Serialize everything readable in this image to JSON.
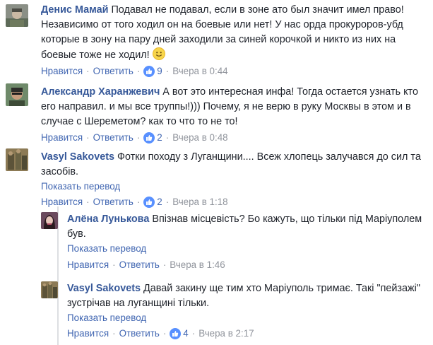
{
  "comments": [
    {
      "author": "Денис Мамай",
      "text": " Подавал не подавал, если в зоне ато был значит имел право! Независимо от того ходил он на боевые или нет! У нас орда прокуроров-убд которые в зону на пару дней заходили за синей корочкой и никто из них на боевые тоже не ходил! ",
      "emoji": "smile-emoji",
      "like_label": "Нравится",
      "reply_label": "Ответить",
      "likes": "9",
      "time": "Вчера в 0:44"
    },
    {
      "author": "Александр Харанжевич",
      "text": " А вот это интересная инфа! Тогда остается узнать кто его направил. и мы все труппы!))) Почему, я не верю в руку Москвы в этом и в случае с Шереметом? как то что то не то!",
      "like_label": "Нравится",
      "reply_label": "Ответить",
      "likes": "2",
      "time": "Вчера в 0:48"
    },
    {
      "author": "Vasyl Sakovets",
      "text": " Фотки походу з Луганщини.... Всеж хлопець залучався до сил та засобів.",
      "translate_label": "Показать перевод",
      "like_label": "Нравится",
      "reply_label": "Ответить",
      "likes": "2",
      "time": "Вчера в 1:18"
    }
  ],
  "replies": [
    {
      "author": "Алёна Лунькова",
      "text": " Впізнав місцевість? Бо кажуть, що тільки під Маріуполем був.",
      "translate_label": "Показать перевод",
      "like_label": "Нравится",
      "reply_label": "Ответить",
      "time": "Вчера в 1:46"
    },
    {
      "author": "Vasyl Sakovets",
      "text": " Давай закину ще тим хто Маріуполь тримає. Такі \"пейзажі\" зустрічав на луганщині тільки.",
      "translate_label": "Показать перевод",
      "like_label": "Нравится",
      "reply_label": "Ответить",
      "likes": "4",
      "time": "Вчера в 2:17"
    }
  ],
  "colors": {
    "link": "#4267b2",
    "author": "#365899",
    "meta": "#90949c",
    "like_badge": "#5890ff",
    "thread_line": "#dddfe2"
  }
}
